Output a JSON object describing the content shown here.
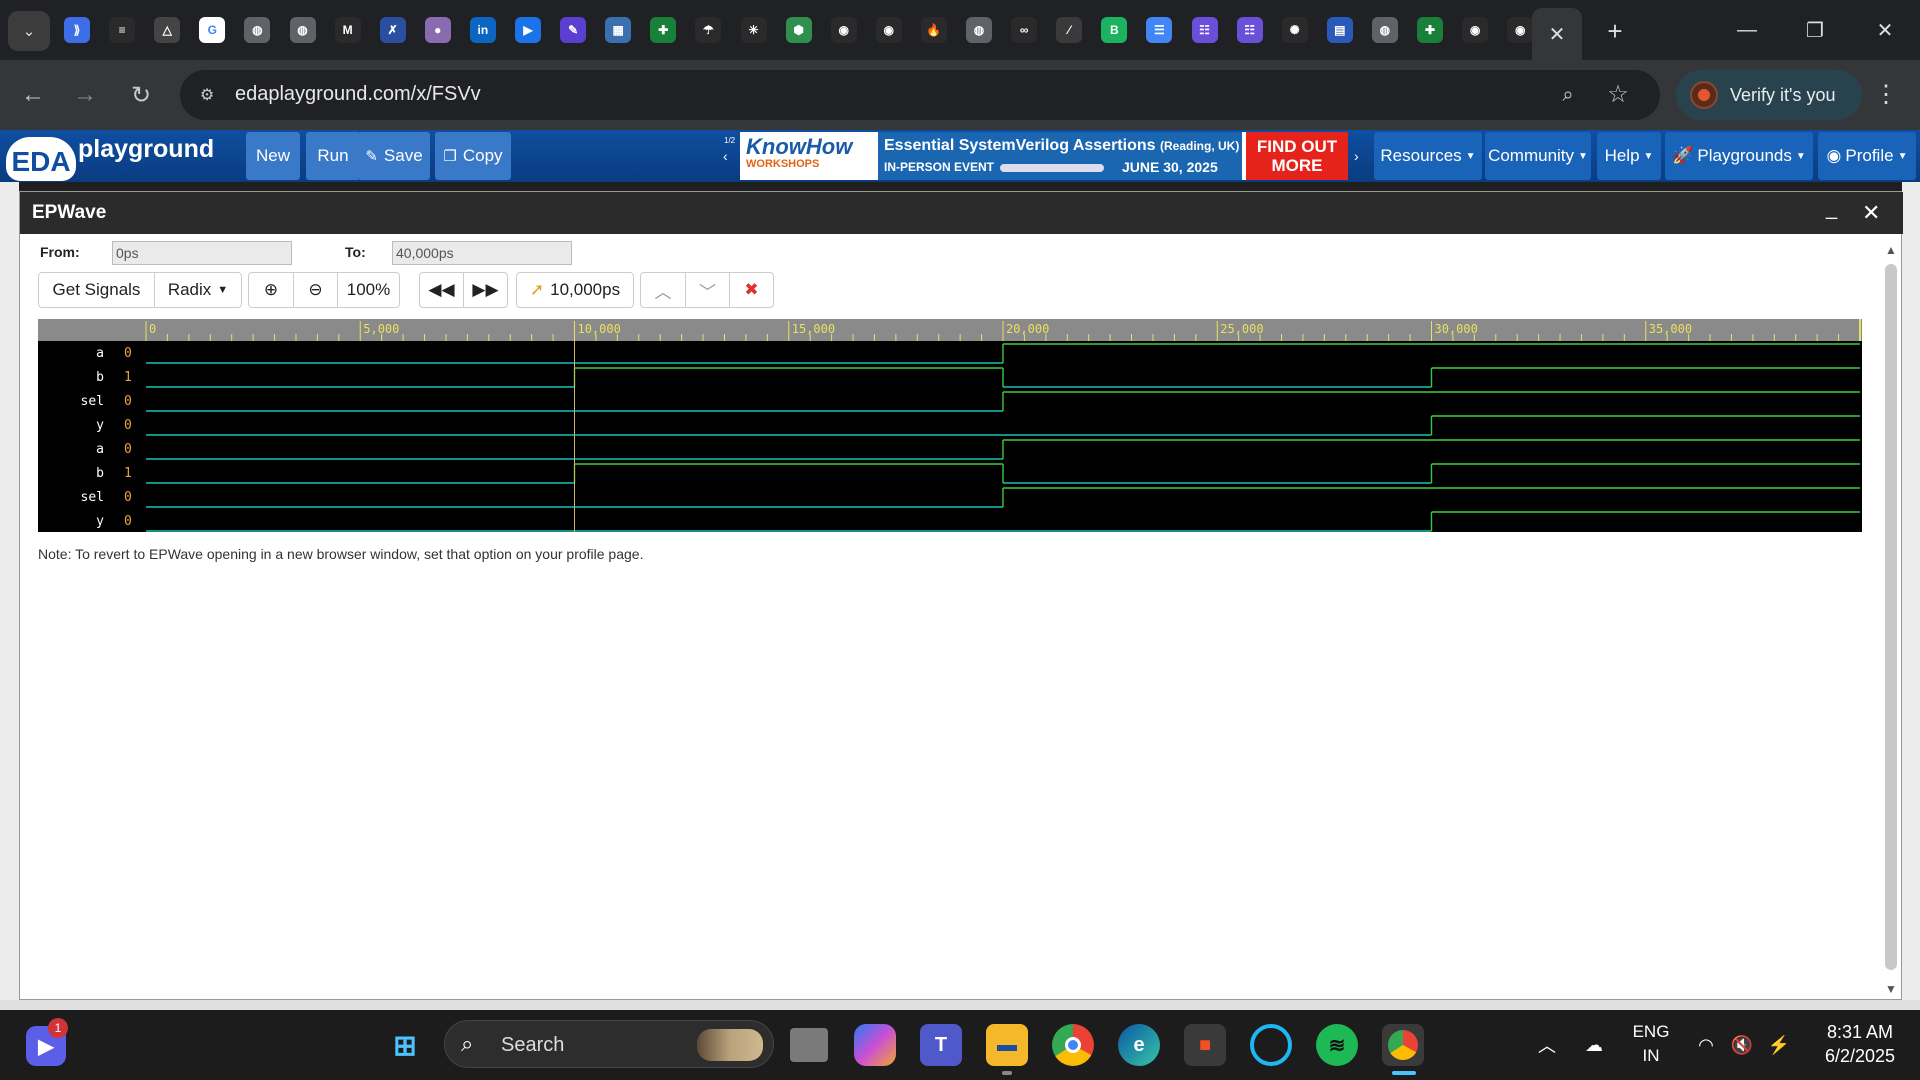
{
  "browser": {
    "tab_close_glyph": "✕",
    "new_tab_glyph": "+",
    "url": "edaplayground.com/x/FSVv",
    "verify_label": "Verify it's you",
    "favicons": [
      {
        "name": "favicon-blue-k",
        "color": "#3d6ee8",
        "glyph": "⟫"
      },
      {
        "name": "favicon-stack",
        "color": "#2a2a2a",
        "glyph": "≡"
      },
      {
        "name": "favicon-triangle",
        "color": "#444444",
        "glyph": "△"
      },
      {
        "name": "favicon-google",
        "color": "#ffffff",
        "glyph": "G"
      },
      {
        "name": "favicon-globe",
        "color": "#5f6368",
        "glyph": "◍"
      },
      {
        "name": "favicon-globe",
        "color": "#5f6368",
        "glyph": "◍"
      },
      {
        "name": "favicon-gmail",
        "color": "#2a2a2a",
        "glyph": "M"
      },
      {
        "name": "favicon-x-blue",
        "color": "#2a4fa0",
        "glyph": "✗"
      },
      {
        "name": "favicon-avatar",
        "color": "#8a6bb0",
        "glyph": "●"
      },
      {
        "name": "favicon-linkedin",
        "color": "#0a66c2",
        "glyph": "in"
      },
      {
        "name": "favicon-video",
        "color": "#1a73e8",
        "glyph": "▶"
      },
      {
        "name": "favicon-pen",
        "color": "#5b3fd1",
        "glyph": "✎"
      },
      {
        "name": "favicon-doc",
        "color": "#3a6fb0",
        "glyph": "▦"
      },
      {
        "name": "favicon-sheets",
        "color": "#188038",
        "glyph": "✚"
      },
      {
        "name": "favicon-mushroom",
        "color": "#2a2a2a",
        "glyph": "☂"
      },
      {
        "name": "favicon-claude",
        "color": "#2a2a2a",
        "glyph": "✳"
      },
      {
        "name": "favicon-hex",
        "color": "#2f8f4e",
        "glyph": "⬢"
      },
      {
        "name": "favicon-github",
        "color": "#2a2a2a",
        "glyph": "◉"
      },
      {
        "name": "favicon-github",
        "color": "#2a2a2a",
        "glyph": "◉"
      },
      {
        "name": "favicon-fire",
        "color": "#2a2a2a",
        "glyph": "🔥"
      },
      {
        "name": "favicon-globe",
        "color": "#5f6368",
        "glyph": "◍"
      },
      {
        "name": "favicon-infinity",
        "color": "#2a2a2a",
        "glyph": "∞"
      },
      {
        "name": "favicon-slash",
        "color": "#3a3a3a",
        "glyph": "⁄"
      },
      {
        "name": "favicon-b-green",
        "color": "#1bb35f",
        "glyph": "B"
      },
      {
        "name": "favicon-docs",
        "color": "#4285f4",
        "glyph": "☰"
      },
      {
        "name": "favicon-list-purple",
        "color": "#6a4fd8",
        "glyph": "☷"
      },
      {
        "name": "favicon-list-purple",
        "color": "#6a4fd8",
        "glyph": "☷"
      },
      {
        "name": "favicon-openai",
        "color": "#2a2a2a",
        "glyph": "✺"
      },
      {
        "name": "favicon-calendar",
        "color": "#2a5ab8",
        "glyph": "▤"
      },
      {
        "name": "favicon-globe",
        "color": "#5f6368",
        "glyph": "◍"
      },
      {
        "name": "favicon-sheets",
        "color": "#188038",
        "glyph": "✚"
      },
      {
        "name": "favicon-github",
        "color": "#2a2a2a",
        "glyph": "◉"
      },
      {
        "name": "favicon-github",
        "color": "#2a2a2a",
        "glyph": "◉"
      }
    ]
  },
  "eda": {
    "logo_text": "EDA",
    "logo_word": "playground",
    "buttons": {
      "new": "New",
      "run": "Run",
      "save": "Save",
      "copy": "Copy"
    },
    "banner": {
      "pager": "1/2",
      "brand_1": "KnowHow",
      "brand_2": "WORKSHOPS",
      "title": "Essential SystemVerilog Assertions",
      "location": "(Reading, UK)",
      "event_type": "IN-PERSON EVENT",
      "date": "JUNE 30, 2025",
      "cta_1": "FIND OUT",
      "cta_2": "MORE"
    },
    "menus": {
      "resources": "Resources",
      "community": "Community",
      "help": "Help",
      "playgrounds": "Playgrounds",
      "profile": "Profile"
    }
  },
  "epwave": {
    "title": "EPWave",
    "from_label": "From:",
    "from_value": "0ps",
    "to_label": "To:",
    "to_value": "40,000ps",
    "get_signals": "Get Signals",
    "radix": "Radix",
    "zoom_level": "100%",
    "cursor_time": "10,000ps",
    "note": "Note: To revert to EPWave opening in a new browser window, set that option on your profile page.",
    "time_ticks": [
      "0",
      "5,000",
      "10,000",
      "15,000",
      "20,000",
      "25,000",
      "30,000",
      "35,000"
    ],
    "time_range": [
      0,
      40000
    ],
    "cursor_ps": 10000,
    "signals": [
      {
        "name": "a",
        "value": "0",
        "transitions": [
          [
            0,
            0
          ],
          [
            20000,
            1
          ]
        ]
      },
      {
        "name": "b",
        "value": "1",
        "transitions": [
          [
            0,
            0
          ],
          [
            10000,
            1
          ],
          [
            20000,
            0
          ],
          [
            30000,
            1
          ]
        ]
      },
      {
        "name": "sel",
        "value": "0",
        "transitions": [
          [
            0,
            0
          ],
          [
            20000,
            1
          ]
        ]
      },
      {
        "name": "y",
        "value": "0",
        "transitions": [
          [
            0,
            0
          ],
          [
            30000,
            1
          ]
        ]
      },
      {
        "name": "a",
        "value": "0",
        "transitions": [
          [
            0,
            0
          ],
          [
            20000,
            1
          ]
        ]
      },
      {
        "name": "b",
        "value": "1",
        "transitions": [
          [
            0,
            0
          ],
          [
            10000,
            1
          ],
          [
            20000,
            0
          ],
          [
            30000,
            1
          ]
        ]
      },
      {
        "name": "sel",
        "value": "0",
        "transitions": [
          [
            0,
            0
          ],
          [
            20000,
            1
          ]
        ]
      },
      {
        "name": "y",
        "value": "0",
        "transitions": [
          [
            0,
            0
          ],
          [
            30000,
            1
          ]
        ]
      }
    ],
    "colors": {
      "low": "#18c0b8",
      "high": "#3ec93e",
      "ruler_text": "#e8e060",
      "signal_value": "#e8a640",
      "cursor": "#c8b870"
    }
  },
  "taskbar": {
    "search_label": "Search",
    "notification_count": "1",
    "language_1": "ENG",
    "language_2": "IN",
    "time": "8:31 AM",
    "date": "6/2/2025"
  }
}
